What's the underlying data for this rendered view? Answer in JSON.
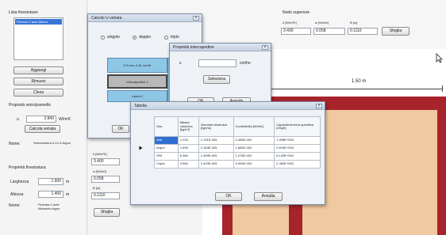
{
  "left_panel": {
    "list_title": "Lista finestrature",
    "list_items": [
      "Finestra 2 ante Albero"
    ],
    "add_button": "Aggiungi",
    "remove_button": "Rimuovi",
    "clone_button": "Clona",
    "glazing_props_title": "Proprietà vetro/pannello",
    "u_label": "u",
    "u_value": "2.840",
    "u_unit": "W/m²K",
    "calc_button": "Calcola vetrata",
    "name_label": "Nome:",
    "name_value": "Vetrocamera 4-12-4 Argon",
    "frame_props_title": "Proprietà finestratura",
    "width_label": "Larghezza",
    "width_value": "1.600",
    "width_unit": "m",
    "height_label": "Altezza",
    "height_value": "1.400",
    "height_unit": "m",
    "name2_label": "Nome:",
    "name2_value": "Finestra 2 ante Alluminio-legno"
  },
  "top_right": {
    "section_title": "Nodo superiore",
    "col1_header": "k [W/m²K]",
    "col2_header": "w [W/mK]",
    "col3_header": "B [m]",
    "col1_value": "3.400",
    "col2_value": "0.058",
    "col3_value": "0.1110",
    "button": "Sfoglia"
  },
  "mid_panel": {
    "k_label": "k [W/m²K]",
    "k_value": "3.400",
    "w_label": "w [W/mK]",
    "w_value": "0.058",
    "b_label": "B [m]",
    "b_value": "0.1110",
    "button": "Sfoglia"
  },
  "canvas": {
    "dimension_label": "1.50 m"
  },
  "calc_dialog": {
    "title": "Calcolo U vetrata",
    "close": "×",
    "radio_labels": [
      "singolo",
      "doppio",
      "triplo"
    ],
    "radio_selected": 1,
    "layer1": "0.0 mm, 0.31 m/mK",
    "layer2": "Intercapedine 1",
    "layer3": "Lastra 2",
    "ok_button": "OK"
  },
  "interspace_dialog": {
    "title": "Proprietà intercapedine",
    "close": "×",
    "s_label": "s",
    "s_value": "",
    "s_unit": "cm/ho",
    "select_button": "Seleziona",
    "ok_button": "OK",
    "cancel_button": "Annulla"
  },
  "table_dialog": {
    "title": "Tabella",
    "close": "×",
    "headers": [
      "Gas",
      "Massa volumica [kg/m³]",
      "Viscosità dinamica [kg/ms]",
      "Conduttività [W/mK]",
      "Capacità termica specifica [J/kgK]"
    ],
    "rows": [
      [
        "Aria",
        "1.232",
        "1.761E-005",
        "2.496E-002",
        "1.008E+003"
      ],
      [
        "Argon",
        "1.699",
        "2.164E-005",
        "1.684E-002",
        "0.519E+002"
      ],
      [
        "SF6",
        "6.360",
        "1.459E-005",
        "1.276E-002",
        "6.143E+002"
      ],
      [
        "Cripto",
        "3.560",
        "2.403E-005",
        "9.000E-003",
        "2.450E+002"
      ]
    ],
    "selected_row": 0,
    "ok_button": "OK",
    "cancel_button": "Annulla"
  },
  "colors": {
    "frame_red": "#a8242b",
    "glass_beige": "#f0c9a0",
    "selection_blue": "#2f6fcf",
    "layer_blue": "#8ec6e6"
  },
  "icons": {
    "cursor": "arrow-cursor-icon",
    "row_marker": "row-pointer-icon",
    "close": "close-icon"
  }
}
